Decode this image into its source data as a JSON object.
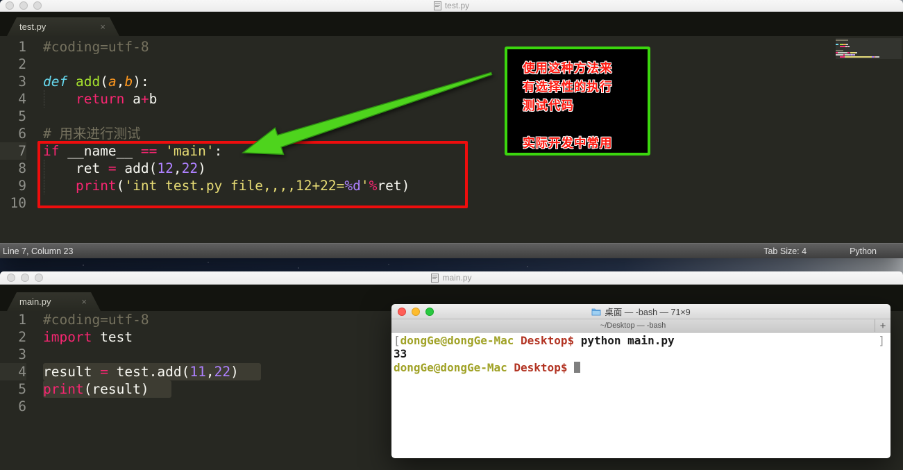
{
  "top_window": {
    "titlebar": {
      "title": "test.py"
    },
    "tab": {
      "label": "test.py",
      "close": "×"
    },
    "status": {
      "position": "Line 7, Column 23",
      "tab_size": "Tab Size: 4",
      "syntax": "Python"
    },
    "code": [
      {
        "n": "1",
        "seg": [
          [
            "#coding=utf-8",
            "cm"
          ]
        ]
      },
      {
        "n": "2",
        "seg": []
      },
      {
        "n": "3",
        "seg": [
          [
            "def",
            "kwi"
          ],
          [
            " ",
            "pl"
          ],
          [
            "add",
            "fn"
          ],
          [
            "(",
            "pl"
          ],
          [
            "a",
            "pr"
          ],
          [
            ",",
            "pl"
          ],
          [
            "b",
            "pr"
          ],
          [
            "):",
            "pl"
          ]
        ]
      },
      {
        "n": "4",
        "seg": [
          [
            "    ",
            "pl"
          ],
          [
            "return",
            "kw"
          ],
          [
            " a",
            "pl"
          ],
          [
            "+",
            "kw"
          ],
          [
            "b",
            "pl"
          ]
        ]
      },
      {
        "n": "5",
        "seg": []
      },
      {
        "n": "6",
        "seg": [
          [
            "# 用来进行测试",
            "cm"
          ]
        ]
      },
      {
        "n": "7",
        "hl": true,
        "seg": [
          [
            "if",
            "kw"
          ],
          [
            " __name__ ",
            "pl"
          ],
          [
            "==",
            "kw"
          ],
          [
            " ",
            "pl"
          ],
          [
            "'main'",
            "st"
          ],
          [
            ":",
            "pl"
          ]
        ]
      },
      {
        "n": "8",
        "seg": [
          [
            "    ret ",
            "pl"
          ],
          [
            "=",
            "kw"
          ],
          [
            " add(",
            "pl"
          ],
          [
            "12",
            "nu"
          ],
          [
            ",",
            "pl"
          ],
          [
            "22",
            "nu"
          ],
          [
            ")",
            "pl"
          ]
        ]
      },
      {
        "n": "9",
        "seg": [
          [
            "    ",
            "pl"
          ],
          [
            "print",
            "kw"
          ],
          [
            "(",
            "pl"
          ],
          [
            "'int test.py file,,,,12+22=",
            "st"
          ],
          [
            "%d",
            "nu"
          ],
          [
            "'",
            "st"
          ],
          [
            "%",
            "kw"
          ],
          [
            "ret)",
            "pl"
          ]
        ]
      },
      {
        "n": "10",
        "seg": []
      }
    ]
  },
  "annotation": {
    "lines": [
      "使用这种方法来",
      "有选择性的执行",
      "测试代码",
      "",
      "实际开发中常用"
    ]
  },
  "bottom_window": {
    "titlebar": {
      "title": "main.py"
    },
    "tab": {
      "label": "main.py",
      "close": "×"
    },
    "code": [
      {
        "n": "1",
        "seg": [
          [
            "#coding=utf-8",
            "cm"
          ]
        ]
      },
      {
        "n": "2",
        "seg": [
          [
            "import",
            "kw"
          ],
          [
            " test",
            "pl"
          ]
        ]
      },
      {
        "n": "3",
        "seg": []
      },
      {
        "n": "4",
        "hl": true,
        "sel": true,
        "seg": [
          [
            "result ",
            "pl"
          ],
          [
            "=",
            "kw"
          ],
          [
            " test.add(",
            "pl"
          ],
          [
            "11",
            "nu"
          ],
          [
            ",",
            "pl"
          ],
          [
            "22",
            "nu"
          ],
          [
            ")",
            "pl"
          ]
        ]
      },
      {
        "n": "5",
        "sel": true,
        "seg": [
          [
            "print",
            "kw"
          ],
          [
            "(result)",
            "pl"
          ]
        ]
      },
      {
        "n": "6",
        "seg": []
      }
    ]
  },
  "terminal": {
    "title": "桌面 — -bash — 71×9",
    "tab_title": "~/Desktop — -bash",
    "new_tab": "+",
    "lines": [
      {
        "seg": [
          [
            "[",
            "mk"
          ],
          [
            "dongGe@dongGe-Mac ",
            "usr"
          ],
          [
            "Desktop$ ",
            "dir"
          ],
          [
            "python main.py",
            "txt"
          ]
        ],
        "right_mark": "]"
      },
      {
        "seg": [
          [
            "33",
            "txt"
          ]
        ]
      },
      {
        "seg": [
          [
            "dongGe@dongGe-Mac ",
            "usr"
          ],
          [
            "Desktop$ ",
            "dir"
          ]
        ],
        "cursor": true
      }
    ]
  },
  "colors": {
    "annotation_border_green": "#3bd60e",
    "annotation_text_red": "#fe1a10",
    "highlight_box_red": "#ee0d0d",
    "arrow_green": "#4ed41d",
    "editor_background": "#272822",
    "terminal_user": "#a0a226",
    "terminal_path": "#b23322"
  }
}
